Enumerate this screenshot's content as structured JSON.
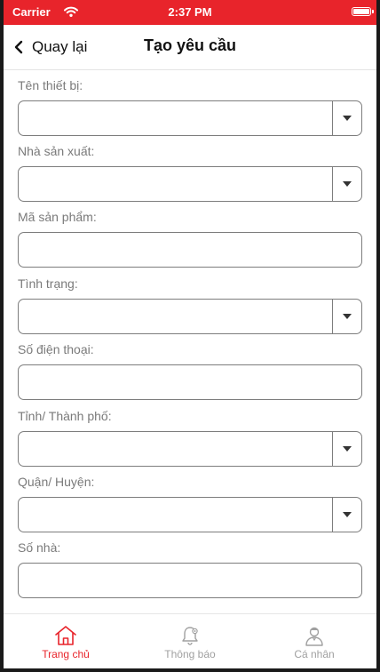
{
  "status_bar": {
    "carrier": "Carrier",
    "time": "2:37 PM"
  },
  "nav": {
    "back_label": "Quay lại",
    "title": "Tạo yêu cầu"
  },
  "form": {
    "fields": [
      {
        "label": "Tên thiết bị:",
        "type": "select",
        "value": ""
      },
      {
        "label": "Nhà sản xuất:",
        "type": "select",
        "value": ""
      },
      {
        "label": "Mã sản phẩm:",
        "type": "text",
        "value": ""
      },
      {
        "label": "Tình trạng:",
        "type": "select",
        "value": ""
      },
      {
        "label": "Số điện thoại:",
        "type": "text",
        "value": ""
      },
      {
        "label": "Tỉnh/ Thành phố:",
        "type": "select",
        "value": ""
      },
      {
        "label": "Quận/ Huyện:",
        "type": "select",
        "value": ""
      },
      {
        "label": "Số nhà:",
        "type": "text",
        "value": ""
      }
    ]
  },
  "tab_bar": {
    "tabs": [
      {
        "label": "Trang chủ",
        "icon": "home-icon",
        "active": true
      },
      {
        "label": "Thông báo",
        "icon": "bell-icon",
        "active": false
      },
      {
        "label": "Cá nhân",
        "icon": "user-icon",
        "active": false
      }
    ]
  },
  "colors": {
    "accent": "#e8242b",
    "inactive": "#a0a0a0",
    "label": "#7a7a7a",
    "border": "#7d7d7d"
  }
}
